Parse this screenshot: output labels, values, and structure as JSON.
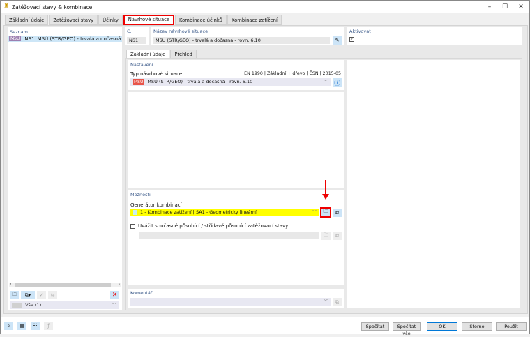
{
  "window": {
    "title": "Zatěžovací stavy & kombinace",
    "minimize": "–",
    "maximize": "☐",
    "close": "✕"
  },
  "tabs": [
    "Základní údaje",
    "Zatěžovací stavy",
    "Účinky",
    "Návrhové situace",
    "Kombinace účinků",
    "Kombinace zatížení"
  ],
  "list": {
    "label": "Seznam",
    "items": [
      {
        "badge": "MSÚ",
        "id": "NS1",
        "name": "MSÚ (STR/GEO) - trvalá a dočasná - rovn. 6.10"
      }
    ],
    "filter": "Vše (1)"
  },
  "number": {
    "label": "Č.",
    "value": "NS1"
  },
  "name": {
    "label": "Název návrhové situace",
    "value": "MSÚ (STR/GEO) - trvalá a dočasná - rovn. 6.10"
  },
  "activate": {
    "label": "Aktivovat",
    "checked": true
  },
  "inner_tabs": [
    "Základní údaje",
    "Přehled"
  ],
  "settings": {
    "heading": "Nastavení",
    "type_label": "Typ návrhové situace",
    "standard": "EN 1990 | Základní + dřevo | ČSN | 2015-05",
    "type_badge": "MSÚ",
    "type_value": "MSÚ (STR/GEO) - trvalá a dočasná - rovn. 6.10"
  },
  "options": {
    "heading": "Možnosti",
    "generator_label": "Generátor kombinací",
    "generator_value": "1 - Kombinace zatížení | SA1 - Geometricky lineární",
    "simultaneous_label": "Uvážit současně působící / střídavě působící zatěžovací stavy",
    "simultaneous_checked": false
  },
  "comment": {
    "label": "Komentář"
  },
  "footer": {
    "calc": "Spočítat",
    "calc_all": "Spočítat vše",
    "ok": "OK",
    "cancel": "Storno",
    "apply": "Použít"
  },
  "colors": {
    "highlight": "#ffff00",
    "accent_red": "#e00000",
    "badge": "#e8554a"
  }
}
